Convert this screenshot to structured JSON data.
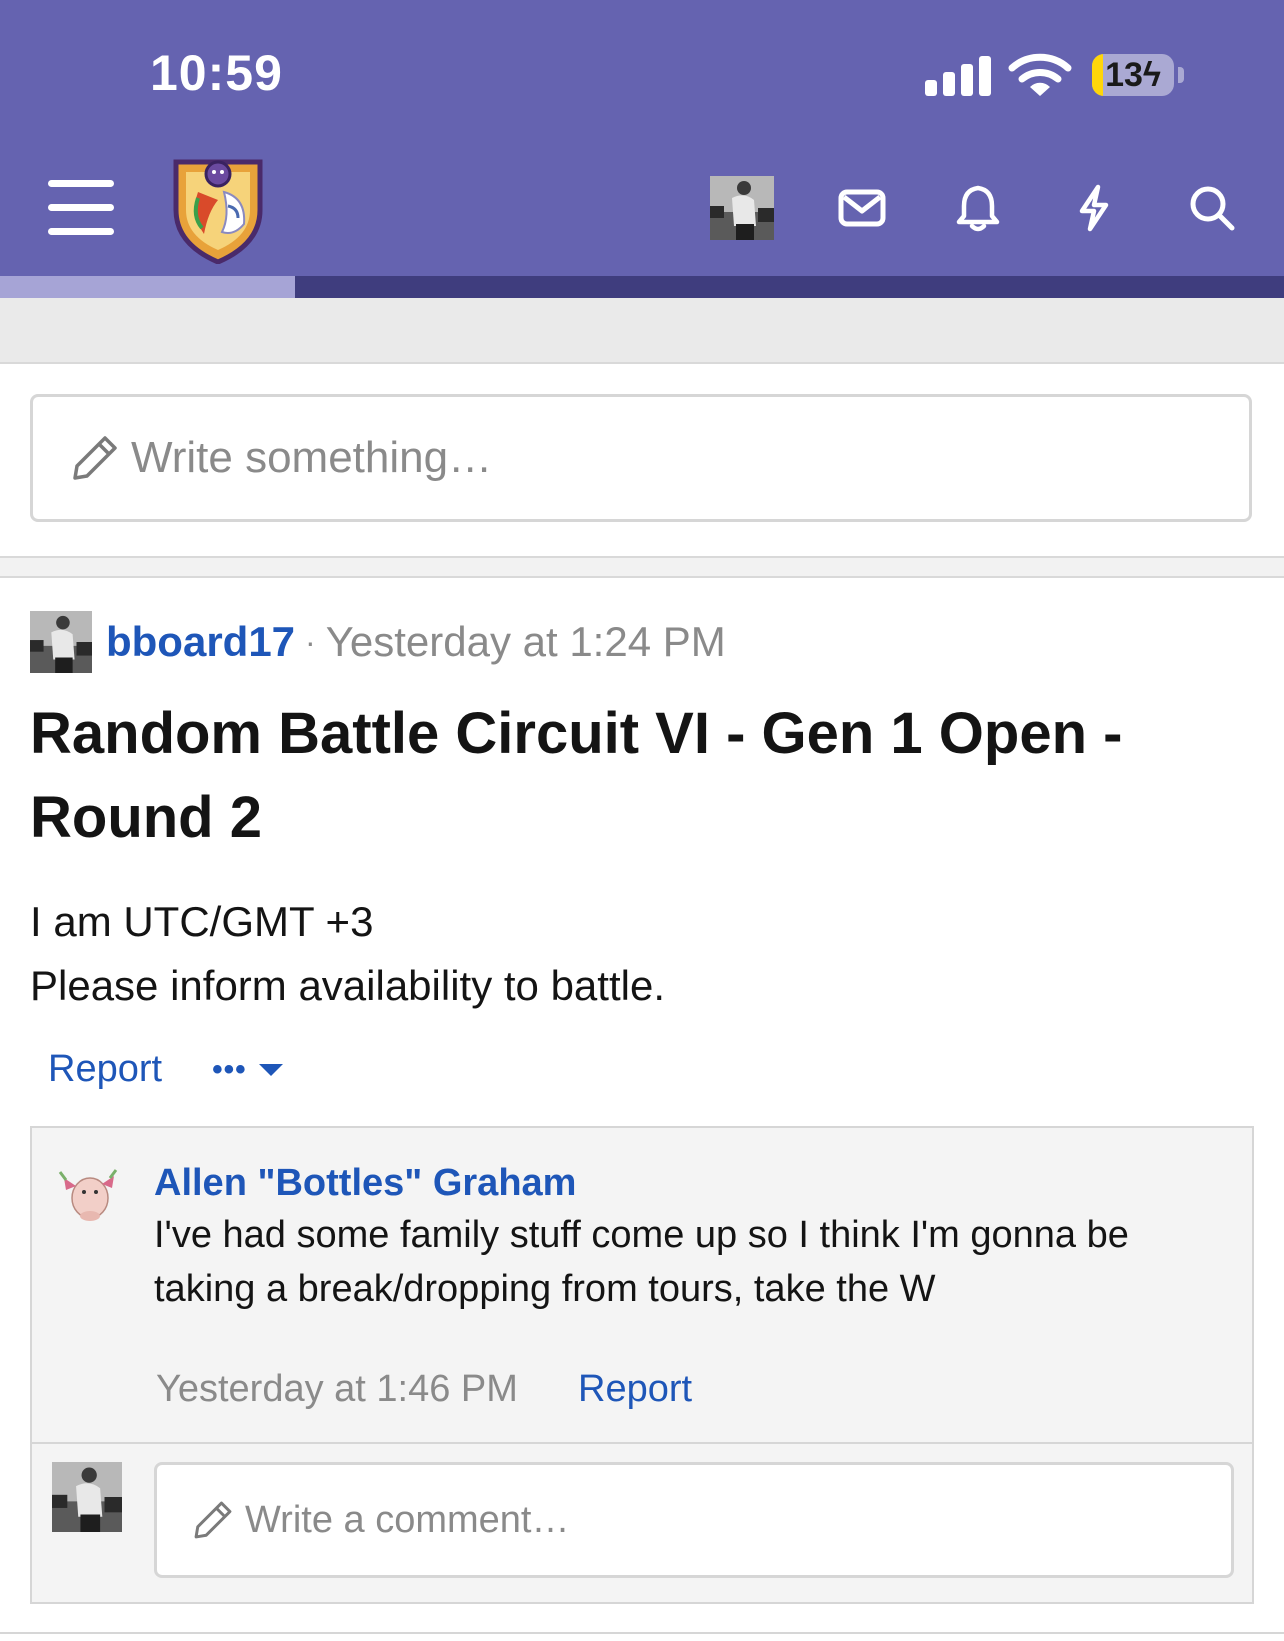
{
  "status_bar": {
    "time": "10:59",
    "battery_text": "13",
    "battery_level": 0.13,
    "icons": [
      "signal-icon",
      "wifi-icon",
      "battery-charging-icon"
    ]
  },
  "header": {
    "icons": [
      "menu-icon",
      "site-logo",
      "avatar",
      "mail-icon",
      "bell-icon",
      "bolt-icon",
      "search-icon"
    ],
    "accent_color": "#6563b0",
    "strip_color": "#3f3d7e",
    "progress": 0.23
  },
  "composer": {
    "placeholder": "Write something…"
  },
  "post": {
    "author": "bboard17",
    "separator": "·",
    "time": "Yesterday at 1:24 PM",
    "title": "Random Battle Circuit VI - Gen 1 Open - Round 2",
    "body_lines": [
      "I am UTC/GMT +3",
      "Please inform availability to battle."
    ],
    "actions": {
      "report": "Report",
      "more": "•••"
    },
    "link_color": "#1e56b8"
  },
  "comments": [
    {
      "author": "Allen \"Bottles\" Graham",
      "text": "I've had some family stuff come up so I think I'm gonna be taking a break/dropping from tours, take the W",
      "time": "Yesterday at 1:46 PM",
      "report": "Report"
    }
  ],
  "reply": {
    "placeholder": "Write a comment…"
  }
}
